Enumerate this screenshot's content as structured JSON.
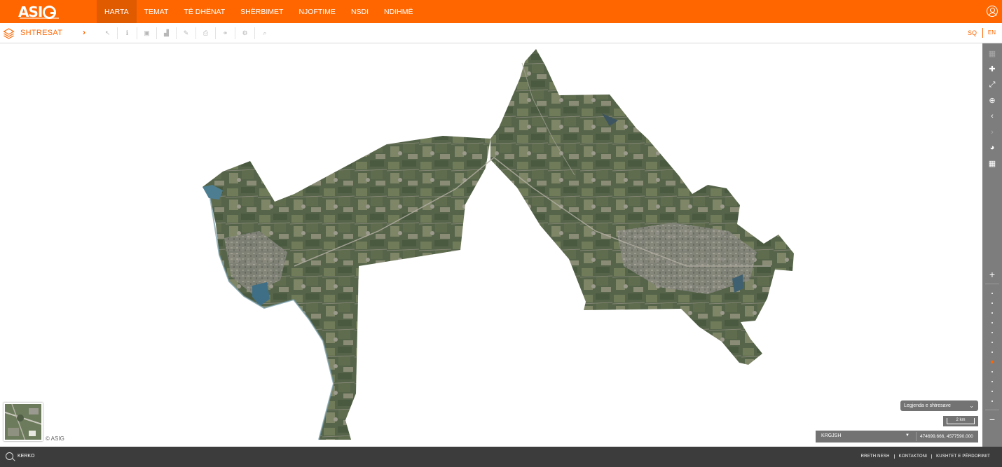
{
  "brand": {
    "logo_text": "ASIG",
    "accent": "#ff6600"
  },
  "nav": {
    "items": [
      {
        "label": "HARTA",
        "active": true
      },
      {
        "label": "TEMAT"
      },
      {
        "label": "TË DHËNAT"
      },
      {
        "label": "SHËRBIMET"
      },
      {
        "label": "NJOFTIME"
      },
      {
        "label": "NSDI"
      },
      {
        "label": "NDIHMË"
      }
    ],
    "user_icon": "user-icon"
  },
  "toolbar": {
    "layers_label": "SHTRESAT",
    "layers_icon": "layers-icon",
    "tools": [
      {
        "name": "select-tool-icon",
        "glyph": "↖"
      },
      {
        "name": "info-tool-icon",
        "glyph": "ℹ"
      },
      {
        "name": "box-tool-icon",
        "glyph": "▣"
      },
      {
        "name": "profile-tool-icon",
        "glyph": "▟"
      },
      {
        "name": "edit-tool-icon",
        "glyph": "✎"
      },
      {
        "name": "print-tool-icon",
        "glyph": "⎙"
      },
      {
        "name": "link-tool-icon",
        "glyph": "⚭"
      },
      {
        "name": "settings-tool-icon",
        "glyph": "⚙"
      },
      {
        "name": "search-tool-icon",
        "glyph": "⌕"
      }
    ],
    "lang_sq": "SQ",
    "lang_en": "EN"
  },
  "side_panel": {
    "buttons": [
      {
        "name": "grid-layer-icon",
        "glyph": "▦",
        "dim": true
      },
      {
        "name": "full-extent-icon",
        "glyph": "✚"
      },
      {
        "name": "fullscreen-icon",
        "glyph": "⤢"
      },
      {
        "name": "zoom-box-icon",
        "glyph": "⊕"
      },
      {
        "name": "previous-extent-icon",
        "glyph": "‹"
      },
      {
        "name": "next-extent-icon",
        "glyph": "›",
        "dim": true
      },
      {
        "name": "globe-icon",
        "glyph": "◕"
      },
      {
        "name": "basemap-grid-icon",
        "glyph": "▦"
      }
    ],
    "zoom_in": "+",
    "zoom_out": "−",
    "zoom_levels": 12,
    "zoom_active_level": 8
  },
  "map": {
    "copyright": "© ASIG",
    "legend_label": "Legjenda e shtresave",
    "scale_label": "2 km",
    "crs_label": "KRGJSH",
    "coordinates": "474699.666, 4577590.000"
  },
  "footer": {
    "search_placeholder": "KËRKO",
    "links": [
      "RRETH NESH",
      "KONTAKTONI",
      "KUSHTET E PËRDORIMIT"
    ]
  }
}
